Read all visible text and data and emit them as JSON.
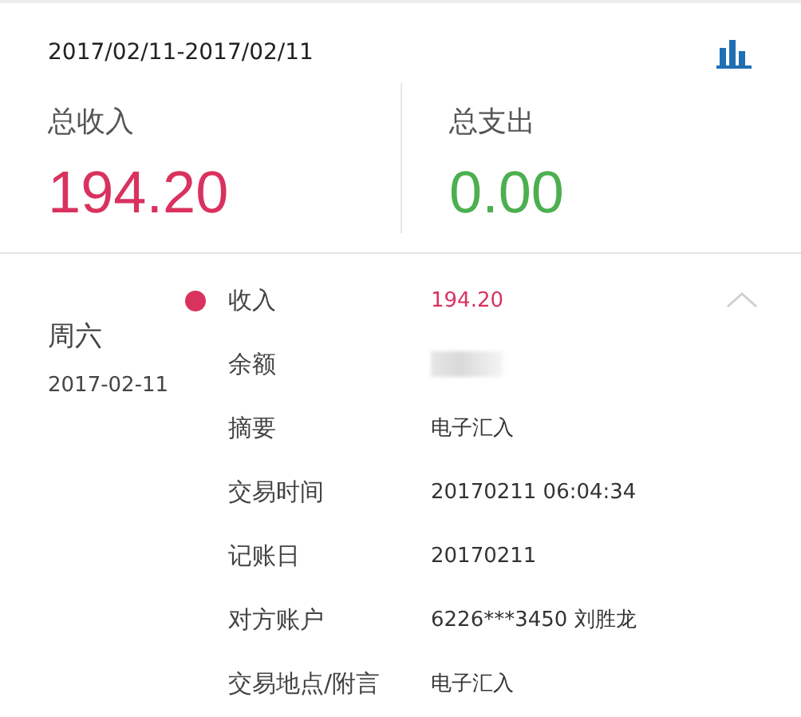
{
  "period": "2017/02/11-2017/02/11",
  "totals": [
    {
      "label": "总收入",
      "value": "194.20",
      "kind": "income"
    },
    {
      "label": "总支出",
      "value": "0.00",
      "kind": "expense"
    }
  ],
  "day": {
    "weekday": "周六",
    "date": "2017-02-11",
    "expanded": true,
    "color": "#d9325e",
    "details": [
      {
        "label": "收入",
        "value": "194.20",
        "kind": "amount"
      },
      {
        "label": "余额",
        "kind": "masked"
      },
      {
        "label": "摘要",
        "value": "电子汇入",
        "kind": "text"
      },
      {
        "label": "交易时间",
        "value": "20170211 06:04:34",
        "kind": "text"
      },
      {
        "label": "记账日",
        "value": "20170211",
        "kind": "text"
      },
      {
        "label": "对方账户",
        "value": "6226***3450 刘胜龙",
        "kind": "text"
      },
      {
        "label": "交易地点/附言",
        "value": "电子汇入",
        "kind": "text"
      }
    ]
  }
}
